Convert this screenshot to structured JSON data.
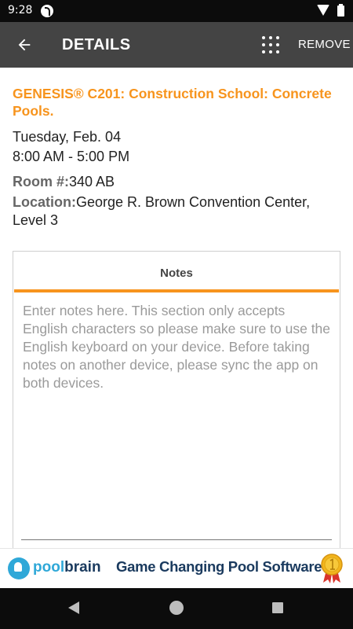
{
  "status_bar": {
    "time": "9:28",
    "icons": [
      "app-notification-icon",
      "wifi-icon",
      "battery-icon"
    ]
  },
  "app_bar": {
    "title": "DETAILS",
    "remove_label": "REMOVE",
    "icons": [
      "back-arrow-icon",
      "grid-menu-icon"
    ]
  },
  "event": {
    "title": "GENESIS® C201: Construction School: Concrete Pools.",
    "date": "Tuesday, Feb. 04",
    "time": "8:00 AM - 5:00 PM",
    "room_label": "Room #:",
    "room_value": "340 AB",
    "location_label": "Location:",
    "location_value": "George R. Brown Convention Center, Level 3"
  },
  "notes": {
    "header": "Notes",
    "value": "",
    "placeholder": "Enter notes here. This section only accepts English characters so please make sure to use the English keyboard on your device. Before taking notes on another device, please sync the app on both devices."
  },
  "ad": {
    "brand_part1": "pool",
    "brand_part2": "brain",
    "headline": "Game Changing Pool Software"
  },
  "colors": {
    "accent": "#f7941d",
    "app_bar": "#444444",
    "status_bar": "#0c0c0c",
    "ad_blue": "#2fa8d8",
    "ad_navy": "#1a3a5e"
  }
}
